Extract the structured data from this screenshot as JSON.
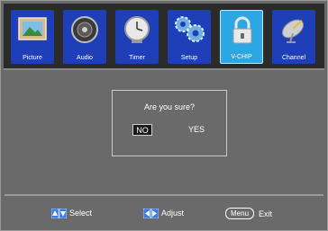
{
  "menu": {
    "tabs": [
      {
        "label": "Picture",
        "icon": "picture-frame-icon"
      },
      {
        "label": "Audio",
        "icon": "speaker-icon"
      },
      {
        "label": "Timer",
        "icon": "clock-icon"
      },
      {
        "label": "Setup",
        "icon": "gears-icon"
      },
      {
        "label": "V-CHIP",
        "icon": "padlock-icon",
        "active": true
      },
      {
        "label": "Channel",
        "icon": "satellite-dish-icon"
      }
    ]
  },
  "dialog": {
    "question": "Are you sure?",
    "no_label": "NO",
    "yes_label": "YES",
    "selected": "NO"
  },
  "footer": {
    "select_label": "Select",
    "adjust_label": "Adjust",
    "menu_key_label": "Menu",
    "exit_label": "Exit"
  },
  "colors": {
    "tile": "#1f3fb8",
    "tile_active": "#2ba8e4",
    "background": "#6a6a6a"
  }
}
